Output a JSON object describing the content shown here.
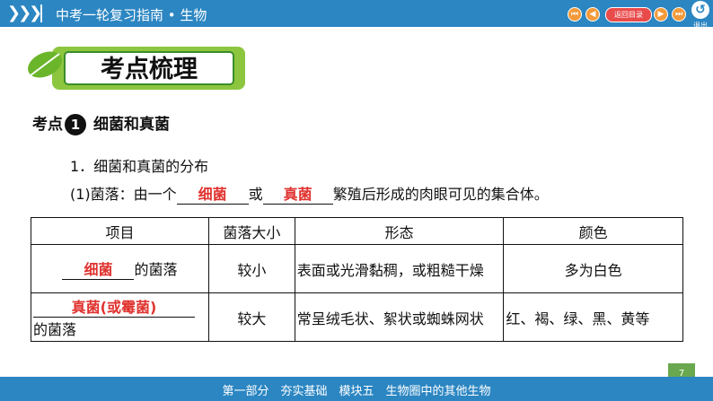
{
  "header": {
    "chevrons": "❯❯❯",
    "title": "中考一轮复习指南 • 生物",
    "nav": {
      "first": "⏮",
      "prev": "◀",
      "back_label": "返回目录",
      "next": "▶",
      "last": "⏭"
    },
    "exit_label": "退出"
  },
  "section": {
    "banner_title": "考点梳理",
    "heading_prefix": "考点",
    "heading_number": "1",
    "heading_text": "细菌和真菌"
  },
  "content": {
    "item1": "1．细菌和真菌的分布",
    "item2": {
      "prefix": "(1)菌落：由一个",
      "blank1": "细菌",
      "mid": "或",
      "blank2": "真菌",
      "suffix": "繁殖后形成的肉眼可见的集合体。"
    }
  },
  "table": {
    "headers": [
      "项目",
      "菌落大小",
      "形态",
      "颜色"
    ],
    "row1": {
      "answer": "细菌",
      "label_suffix": "的菌落",
      "size": "较小",
      "shape": "表面或光滑黏稠，或粗糙干燥",
      "color": "多为白色"
    },
    "row2": {
      "answer": "真菌(或霉菌)",
      "label_suffix": "的菌落",
      "size": "较大",
      "shape": "常呈绒毛状、絮状或蜘蛛网状",
      "color": "红、褐、绿、黑、黄等"
    }
  },
  "footer": {
    "page_number": "7",
    "text": "第一部分　夯实基础　模块五　生物圈中的其他生物"
  },
  "colors": {
    "header_blue": "#2b86c2",
    "answer_red": "#e0332f",
    "nav_orange": "#f29a3a",
    "back_red": "#e94a4a",
    "banner_green": "#8cc63f"
  },
  "icons": [
    "triple-chevron-icon",
    "first-page-icon",
    "prev-page-icon",
    "next-page-icon",
    "last-page-icon",
    "exit-icon",
    "leaf-icon"
  ]
}
